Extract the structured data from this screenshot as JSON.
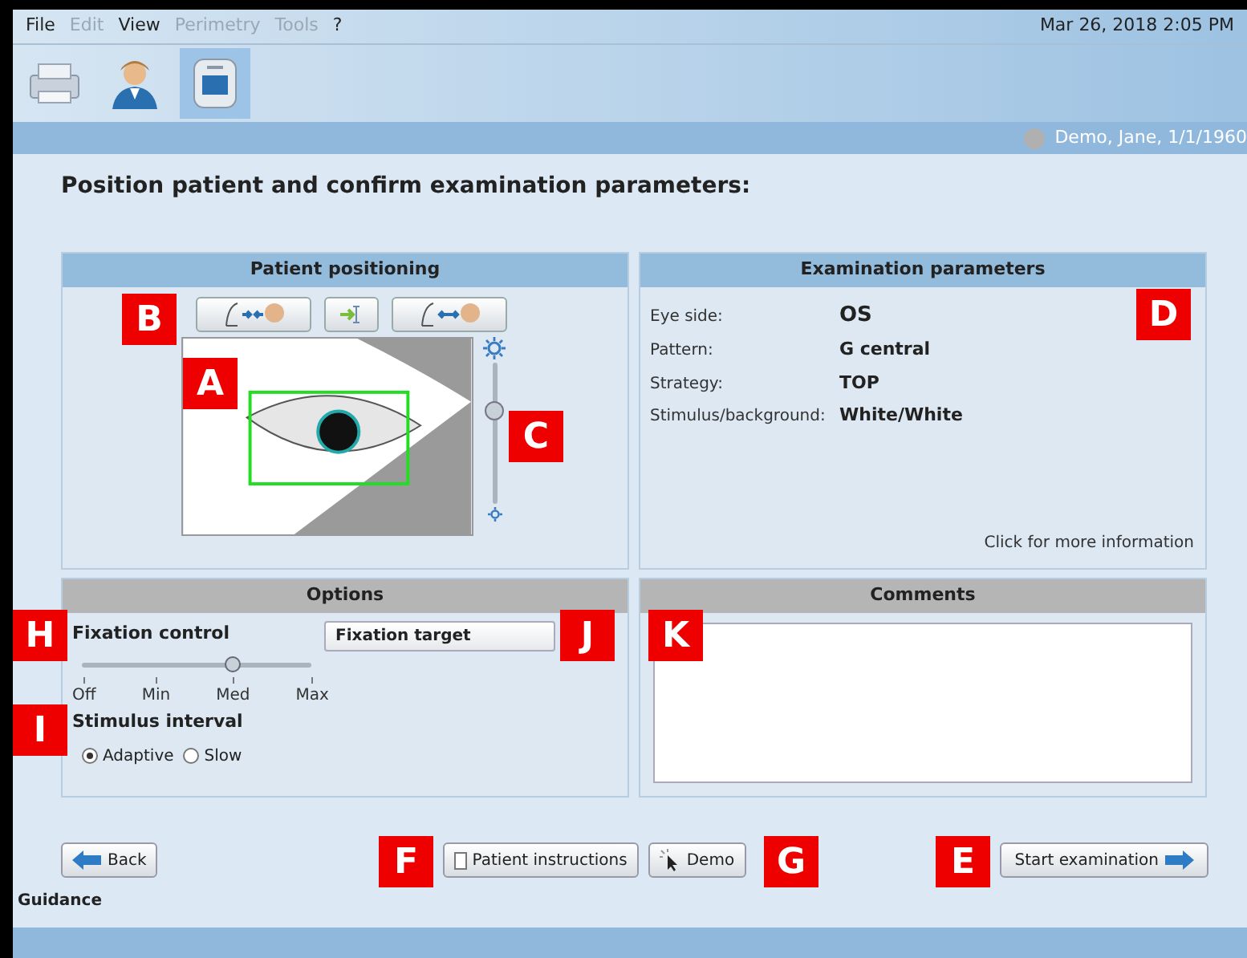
{
  "menu": [
    {
      "label": "File",
      "disabled": false
    },
    {
      "label": "Edit",
      "disabled": true
    },
    {
      "label": "View",
      "disabled": false
    },
    {
      "label": "Perimetry",
      "disabled": true
    },
    {
      "label": "Tools",
      "disabled": true
    },
    {
      "label": "?",
      "disabled": false
    }
  ],
  "datetime": "Mar 26, 2018 2:05 PM",
  "toolbar": [
    {
      "kind": "printer",
      "selected": false
    },
    {
      "kind": "patient",
      "selected": false
    },
    {
      "kind": "perimeter",
      "selected": true
    }
  ],
  "patient": "Demo, Jane, 1/1/1960",
  "heading": "Position patient and confirm examination parameters:",
  "positioning": {
    "title": "Patient positioning",
    "buttons": [
      {
        "kind": "closer"
      },
      {
        "kind": "center"
      },
      {
        "kind": "farther"
      }
    ],
    "brightness": {
      "level": 0.68
    }
  },
  "exam": {
    "title": "Examination parameters",
    "params": [
      {
        "label": "Eye side:",
        "value": "OS"
      },
      {
        "label": "Pattern:",
        "value": "G central"
      },
      {
        "label": "Strategy:",
        "value": "TOP"
      },
      {
        "label": "Stimulus/background:",
        "value": "White/White"
      }
    ],
    "link": "Click for more information"
  },
  "options": {
    "title": "Options",
    "fixation": {
      "label": "Fixation control",
      "level": 0.67,
      "ticks": [
        "Off",
        "Min",
        "Med",
        "Max"
      ]
    },
    "interval": {
      "label": "Stimulus interval",
      "choices": [
        {
          "label": "Adaptive",
          "selected": true
        },
        {
          "label": "Slow",
          "selected": false
        }
      ]
    },
    "target": "Fixation target"
  },
  "comments": {
    "title": "Comments"
  },
  "buttons": {
    "back": "Back",
    "instructions": "Patient instructions",
    "demo": "Demo",
    "start": "Start examination"
  },
  "guidance": "Guidance",
  "callouts": [
    {
      "letter": "B"
    },
    {
      "letter": "D"
    },
    {
      "letter": "A"
    },
    {
      "letter": "C"
    },
    {
      "letter": "H"
    },
    {
      "letter": "J"
    },
    {
      "letter": "K"
    },
    {
      "letter": "I"
    },
    {
      "letter": "F"
    },
    {
      "letter": "G"
    },
    {
      "letter": "E"
    }
  ]
}
